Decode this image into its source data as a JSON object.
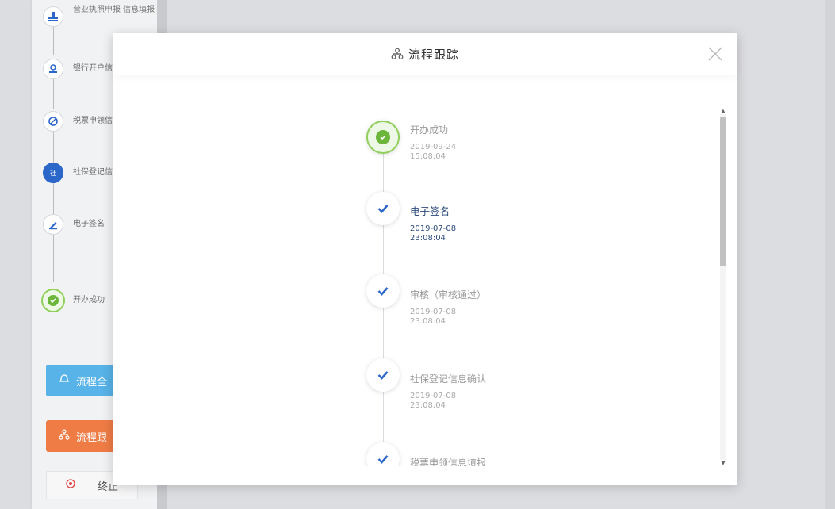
{
  "background": {
    "steps": [
      {
        "label": "营业执照申报 信息填报",
        "icon": "stamp-icon"
      },
      {
        "label": "银行开户信",
        "icon": "bank-user-icon"
      },
      {
        "label": "税票申领信",
        "icon": "tax-ticket-icon"
      },
      {
        "label": "社保登记信",
        "icon": "social-security-icon"
      },
      {
        "label": "电子签名",
        "icon": "pen-icon"
      },
      {
        "label": "开办成功",
        "icon": "success-check-icon"
      }
    ],
    "buttons": {
      "full_process": "流程全",
      "trace": "流程跟",
      "stop": "终止"
    }
  },
  "modal": {
    "title": "流程跟踪",
    "close_icon": "close-icon",
    "timeline": [
      {
        "title": "开办成功",
        "date": "2019-09-24",
        "time": "15:08:04",
        "status": "done"
      },
      {
        "title": "电子签名",
        "date": "2019-07-08",
        "time": "23:08:04",
        "status": "active"
      },
      {
        "title": "审核（审核通过）",
        "date": "2019-07-08",
        "time": "23:08:04",
        "status": "checked"
      },
      {
        "title": "社保登记信息确认",
        "date": "2019-07-08",
        "time": "23:08:04",
        "status": "checked"
      },
      {
        "title": "税票申领信息填报",
        "date": "",
        "time": "",
        "status": "checked"
      }
    ]
  },
  "colors": {
    "accent_blue": "#2b66c9",
    "success_green": "#6cb73b",
    "button_blue": "#57b3e8",
    "button_orange": "#f07c45"
  }
}
